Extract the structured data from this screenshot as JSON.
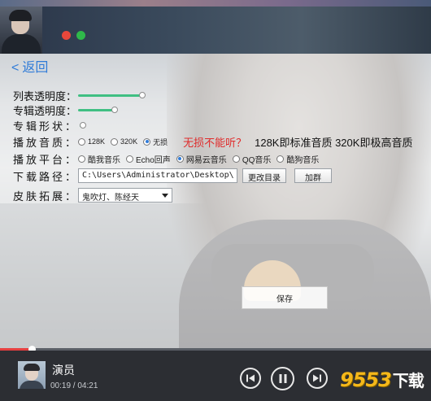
{
  "back": {
    "arrow": "<",
    "label": "返回"
  },
  "settings": {
    "list_opacity": {
      "label": "列表透明度：",
      "value": 0.85
    },
    "album_opacity": {
      "label": "专辑透明度：",
      "value": 0.38
    },
    "album_shape": {
      "label": "专辑形状：",
      "value": 0.0
    },
    "quality": {
      "label": "播放音质：",
      "options": [
        "128K",
        "320K",
        "无损"
      ],
      "selected": "无损",
      "notice": "无损不能听？",
      "hint": "128K即标准音质 320K即极高音质"
    },
    "platform": {
      "label": "播放平台：",
      "options": [
        "酷我音乐",
        "Echo回声",
        "网易云音乐",
        "QQ音乐",
        "酷狗音乐"
      ],
      "selected": "网易云音乐"
    },
    "download": {
      "label": "下载路径：",
      "path": "C:\\Users\\Administrator\\Desktop\\",
      "change_button": "更改目录",
      "join_button": "加群"
    },
    "skin": {
      "label": "皮肤拓展：",
      "selected": "鬼吹灯、陈经天"
    }
  },
  "save_button": "保存",
  "player": {
    "song_title": "演员",
    "time": "00:19 / 04:21",
    "progress": 0.073
  },
  "watermark": {
    "brand": "9553",
    "suffix": "下载"
  }
}
